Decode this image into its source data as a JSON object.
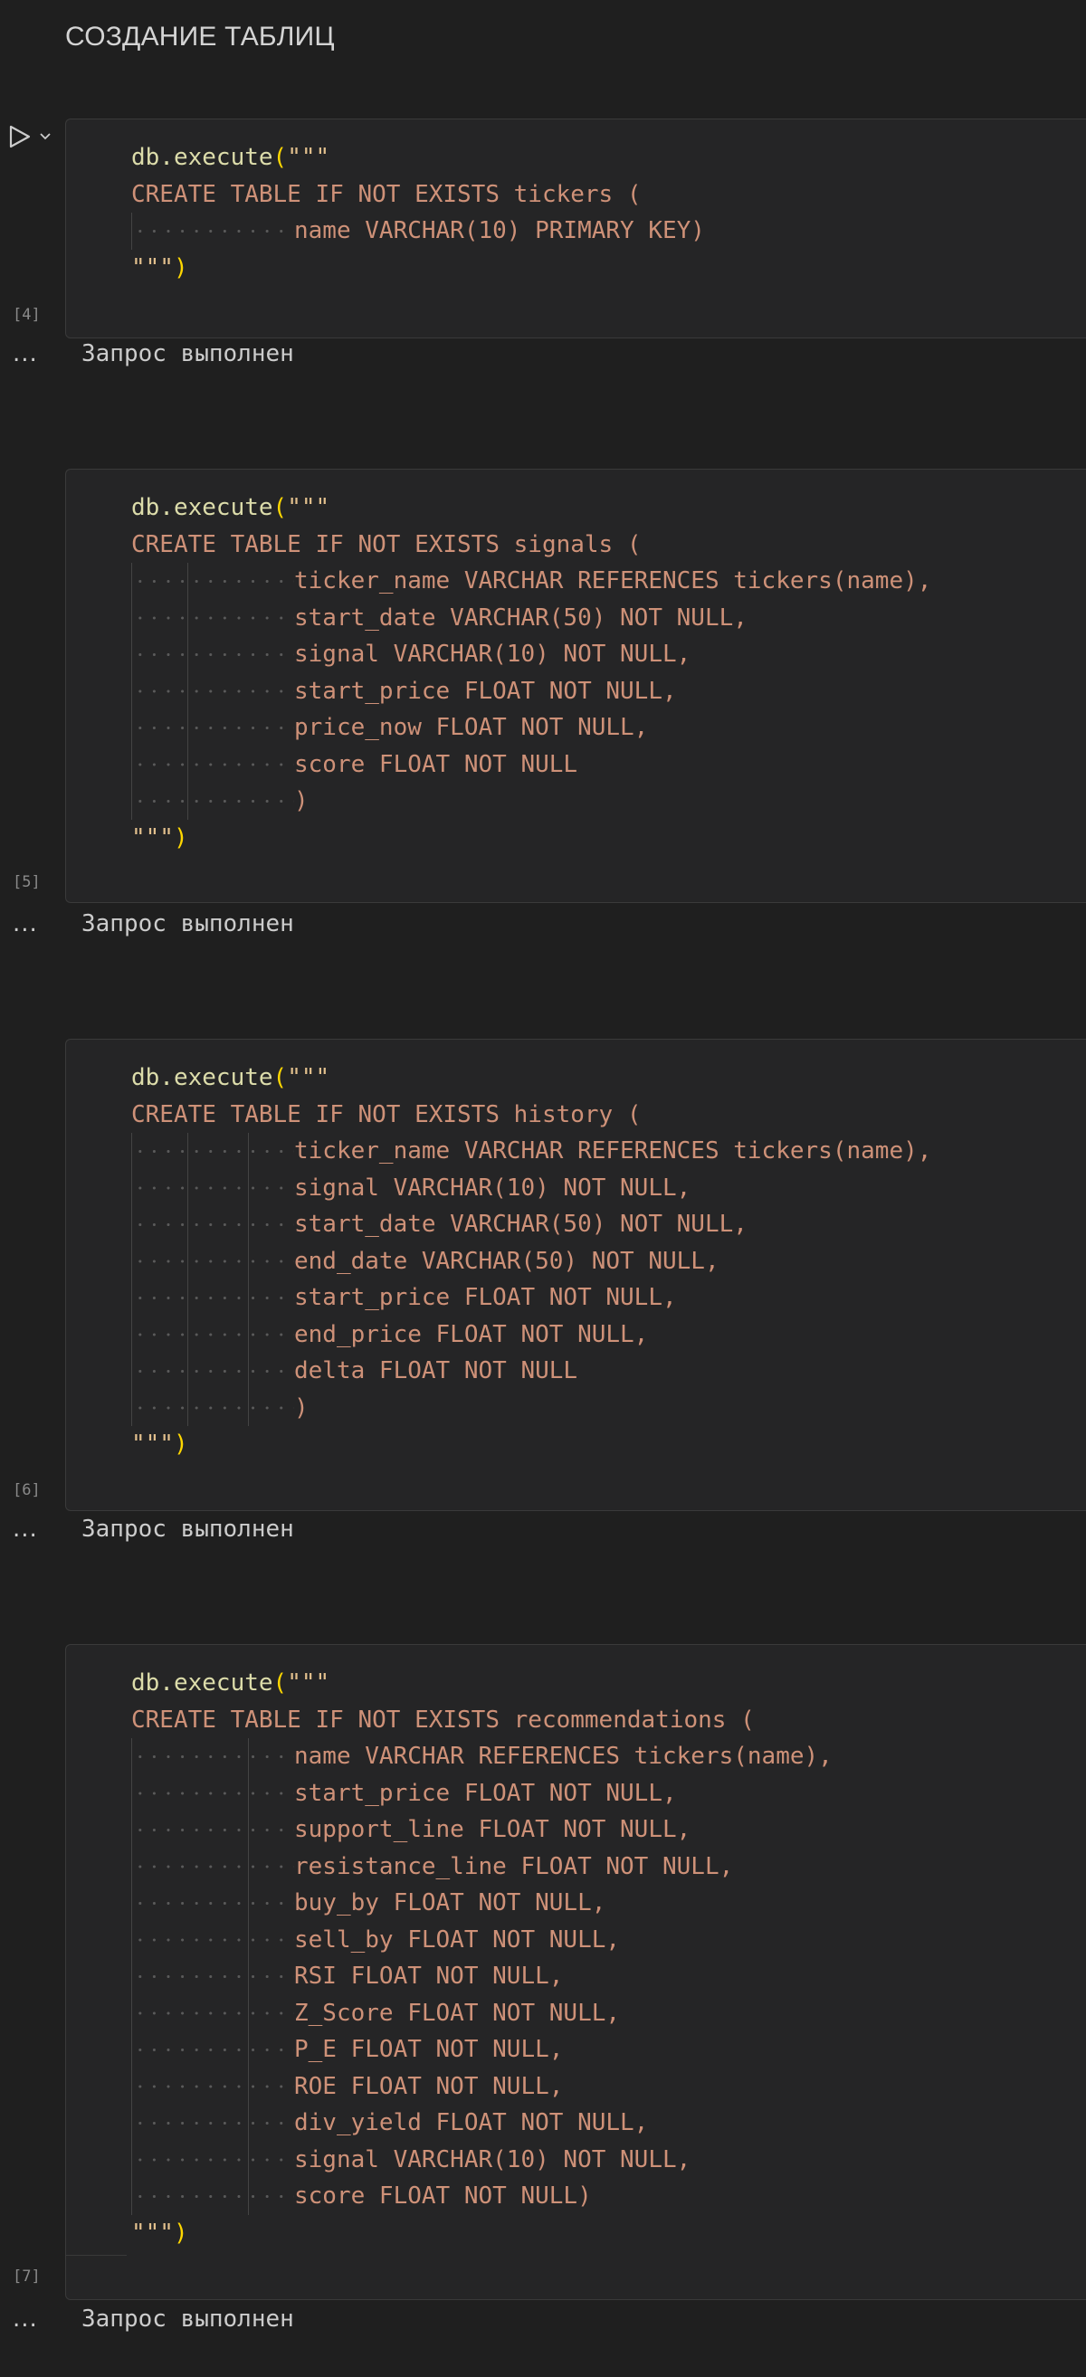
{
  "notebook": {
    "heading": "СОЗДАНИЕ ТАБЛИЦ",
    "run_icon": "play-icon",
    "run_menu_icon": "chevron-down-icon",
    "colors": {
      "background": "#1f1f1f",
      "cell_background": "#252526",
      "sql_text": "#ce9178",
      "function": "#dcdcaa",
      "string_delim": "#e2c08d",
      "paren": "#ffd700"
    }
  },
  "cells": [
    {
      "id": "cell-tickers",
      "exec_count": "[4]",
      "first_line": {
        "fn": "db.execute",
        "open": "(",
        "quote": "\"\"\""
      },
      "create_line": "CREATE TABLE IF NOT EXISTS tickers (",
      "body": [
        "name VARCHAR(10) PRIMARY KEY)"
      ],
      "closing": {
        "quote": "\"\"\"",
        "close": ")"
      },
      "output": {
        "ellipsis": "...",
        "text": "Запрос выполнен"
      }
    },
    {
      "id": "cell-signals",
      "exec_count": "[5]",
      "first_line": {
        "fn": "db.execute",
        "open": "(",
        "quote": "\"\"\""
      },
      "create_line": "CREATE TABLE IF NOT EXISTS signals (",
      "body": [
        "ticker_name VARCHAR REFERENCES tickers(name),",
        "start_date VARCHAR(50) NOT NULL,",
        "signal VARCHAR(10) NOT NULL,",
        "start_price FLOAT NOT NULL,",
        "price_now FLOAT NOT NULL,",
        "score FLOAT NOT NULL",
        ")"
      ],
      "closing": {
        "quote": "\"\"\"",
        "close": ")"
      },
      "output": {
        "ellipsis": "...",
        "text": "Запрос выполнен"
      }
    },
    {
      "id": "cell-history",
      "exec_count": "[6]",
      "first_line": {
        "fn": "db.execute",
        "open": "(",
        "quote": "\"\"\""
      },
      "create_line": "CREATE TABLE IF NOT EXISTS history (",
      "body": [
        "ticker_name VARCHAR REFERENCES tickers(name),",
        "signal VARCHAR(10) NOT NULL,",
        "start_date VARCHAR(50) NOT NULL,",
        "end_date VARCHAR(50) NOT NULL,",
        "start_price FLOAT NOT NULL,",
        "end_price FLOAT NOT NULL,",
        "delta FLOAT NOT NULL",
        ")"
      ],
      "closing": {
        "quote": "\"\"\"",
        "close": ")"
      },
      "output": {
        "ellipsis": "...",
        "text": "Запрос выполнен"
      }
    },
    {
      "id": "cell-recommendations",
      "exec_count": "[7]",
      "first_line": {
        "fn": "db.execute",
        "open": "(",
        "quote": "\"\"\""
      },
      "create_line": "CREATE TABLE IF NOT EXISTS recommendations (",
      "body": [
        "name VARCHAR REFERENCES tickers(name),",
        "start_price FLOAT NOT NULL,",
        "support_line FLOAT NOT NULL,",
        "resistance_line FLOAT NOT NULL,",
        "buy_by FLOAT NOT NULL,",
        "sell_by FLOAT NOT NULL,",
        "RSI FLOAT NOT NULL,",
        "Z_Score FLOAT NOT NULL,",
        "P_E FLOAT NOT NULL,",
        "ROE FLOAT NOT NULL,",
        "div_yield FLOAT NOT NULL,",
        "signal VARCHAR(10) NOT NULL,",
        "score FLOAT NOT NULL)"
      ],
      "closing": {
        "quote": "\"\"\"",
        "close": ")"
      },
      "output": {
        "ellipsis": "...",
        "text": "Запрос выполнен"
      }
    }
  ]
}
